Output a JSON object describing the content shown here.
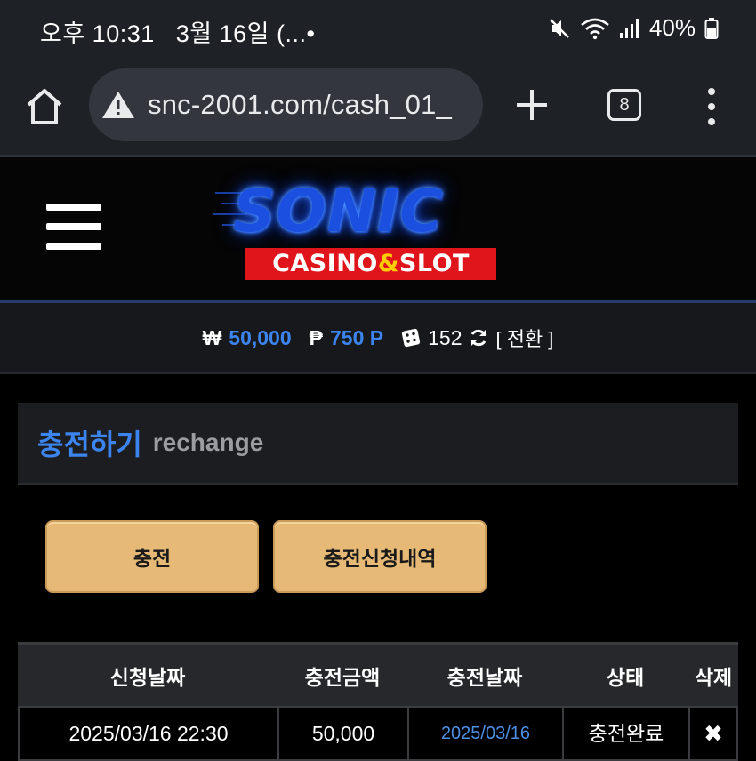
{
  "status_bar": {
    "time": "오후 10:31",
    "date": "3월 16일 (...•",
    "battery": "40%"
  },
  "browser": {
    "url": "snc-2001.com/cash_01_",
    "tab_count": "8"
  },
  "site": {
    "logo_title": "SONIC",
    "logo_sub_left": "CASINO",
    "logo_sub_amp": "&",
    "logo_sub_right": "SLOT"
  },
  "balance": {
    "won_symbol": "₩",
    "won_value": "50,000",
    "point_symbol": "₱",
    "point_value": "750 P",
    "chip_value": "152",
    "convert_label": "[ 전환 ]"
  },
  "section": {
    "title_kr": "충전하기",
    "title_en": "rechange"
  },
  "buttons": {
    "charge": "충전",
    "history": "충전신청내역"
  },
  "table": {
    "headers": [
      "신청날짜",
      "충전금액",
      "충전날짜",
      "상태",
      "삭제"
    ],
    "rows": [
      [
        "2025/03/16 22:30",
        "50,000",
        "2025/03/16",
        "충전완료",
        "✖"
      ]
    ]
  },
  "colors": {
    "accent_blue": "#3d85ee",
    "button_gold": "#e6ba76",
    "logo_red": "#e0141b"
  }
}
